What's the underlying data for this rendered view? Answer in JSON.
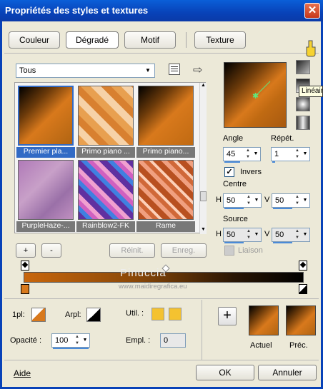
{
  "title": "Propriétés des styles et textures",
  "tabs": [
    {
      "label": "Couleur"
    },
    {
      "label": "Dégradé"
    },
    {
      "label": "Motif"
    },
    {
      "label": "Texture"
    }
  ],
  "category_select": {
    "value": "Tous"
  },
  "gallery": [
    {
      "label": "Premier pla...",
      "selected": true
    },
    {
      "label": "Primo piano ..."
    },
    {
      "label": "Primo piano..."
    },
    {
      "label": "PurpleHaze-..."
    },
    {
      "label": "Rainblow2-FK"
    },
    {
      "label": "Rame"
    }
  ],
  "gallery_buttons": {
    "add": "+",
    "remove": "-",
    "reset": "Réinit.",
    "save": "Enreg."
  },
  "angle": {
    "label": "Angle",
    "value": "45"
  },
  "repeat": {
    "label": "Répét.",
    "value": "1"
  },
  "invert": {
    "label": "Invers",
    "checked": true
  },
  "center": {
    "label": "Centre",
    "h_label": "H",
    "h_value": "50",
    "v_label": "V",
    "v_value": "50"
  },
  "source": {
    "label": "Source",
    "h_label": "H",
    "h_value": "50",
    "v_label": "V",
    "v_value": "50"
  },
  "link": {
    "label": "Liaison",
    "checked": false
  },
  "tooltip": "Linéaire",
  "watermark": {
    "name": "Pinuccia",
    "url": "www.maidiregrafica.eu"
  },
  "bottom": {
    "pl_label": "1pl:",
    "arpl_label": "Arpl:",
    "util_label": "Util. :",
    "empl_label": "Empl. :",
    "empl_value": "0",
    "opacity_label": "Opacité :",
    "opacity_value": "100",
    "add_btn": "+",
    "current_label": "Actuel",
    "previous_label": "Préc.",
    "accent_color": "#f4c230"
  },
  "footer": {
    "help": "Aide",
    "ok": "OK",
    "cancel": "Annuler"
  }
}
